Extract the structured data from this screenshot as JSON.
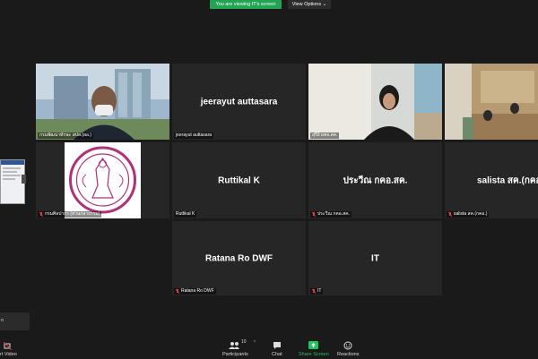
{
  "top": {
    "banner": "You are viewing IT's screen",
    "view_options": "View Options ⌄"
  },
  "tiles": [
    {
      "id": "t1",
      "label": "กรมพัฒนาทักษะ สปส.(ผอ.)",
      "center": "",
      "video": true
    },
    {
      "id": "t2",
      "label": "jeerayut auttasara",
      "center": "jeerayut auttasara",
      "video": false
    },
    {
      "id": "t3",
      "label": "สุรีย์ ผพจ.สค.",
      "center": "",
      "video": true
    },
    {
      "id": "t4",
      "label": "",
      "center": "",
      "video": true
    },
    {
      "id": "t5",
      "label": "กรมศิลปากร (ส่วนกลางกรม)",
      "center": "",
      "video": true
    },
    {
      "id": "t6",
      "label": "Ruttikal K",
      "center": "Ruttikal K",
      "video": false
    },
    {
      "id": "t7",
      "label": "ประวีณ กคอ.สค.",
      "center": "ประวีณ กคอ.สค.",
      "video": false
    },
    {
      "id": "t8",
      "label": "salista สค.(กคอ.)",
      "center": "salista สค.(กคอ",
      "video": false
    },
    {
      "id": "t9",
      "label": "Ratana Ro  DWF",
      "center": "Ratana Ro  DWF",
      "video": false
    },
    {
      "id": "t10",
      "label": "IT",
      "center": "IT",
      "video": false
    }
  ],
  "self_view": {
    "label": "o"
  },
  "toolbar": {
    "start_video": "rt Video",
    "participants_label": "Participants",
    "participants_count": "10",
    "chat": "Chat",
    "share_screen": "Share Screen",
    "reactions": "Reactions"
  },
  "colors": {
    "banner": "#23a455",
    "active_speaker": "#e6d13a",
    "tile_bg": "#262626",
    "background": "#1a1a1a"
  }
}
